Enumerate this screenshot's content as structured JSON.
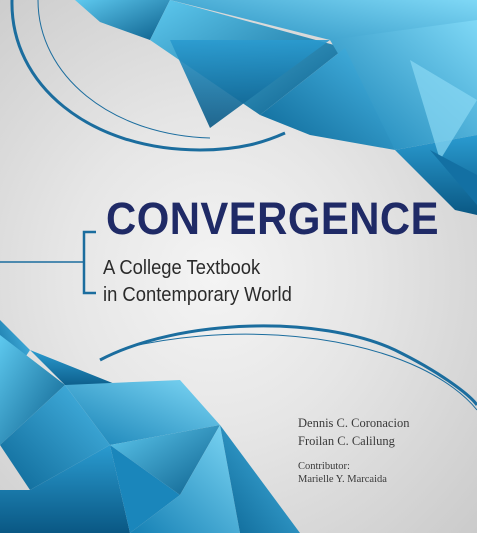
{
  "cover": {
    "title": "CONVERGENCE",
    "subtitle_line1": "A College Textbook",
    "subtitle_line2": "in Contemporary World",
    "authors": [
      "Dennis C. Coronacion",
      "Froilan C. Calilung"
    ],
    "contributor_label": "Contributor:",
    "contributor_name": "Marielle Y. Marcaida"
  },
  "colors": {
    "title": "#1f2a66",
    "accent_blue": "#1b8fc0",
    "light_blue": "#6fd0f2",
    "dark_blue": "#0b5f8c",
    "background": "#e6e6e6"
  }
}
